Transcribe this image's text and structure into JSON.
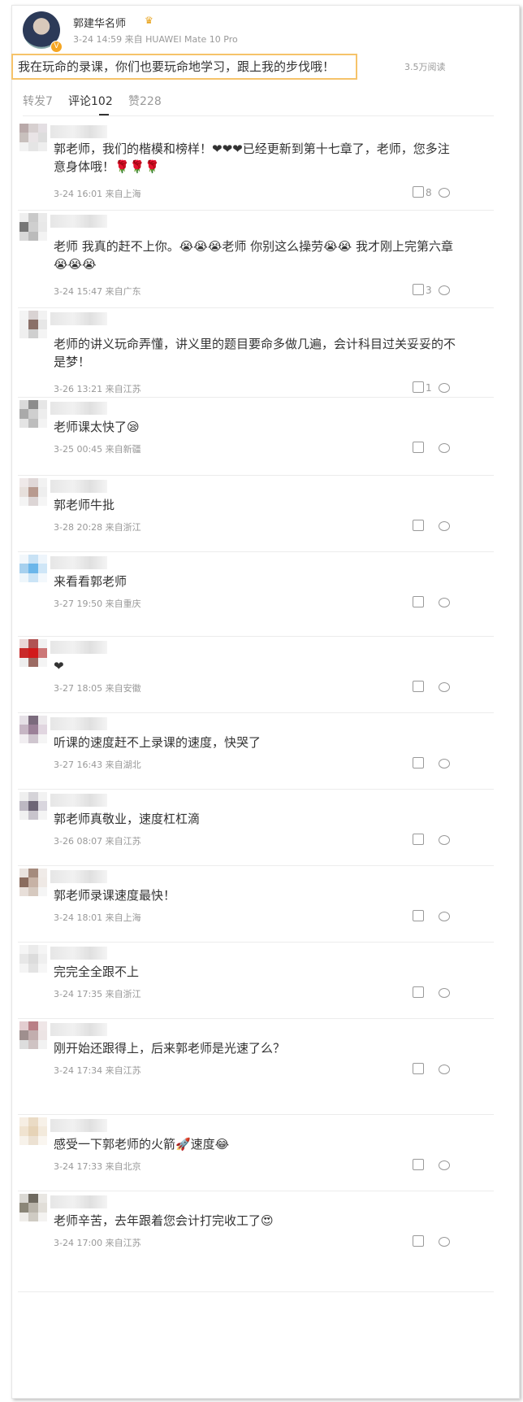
{
  "post": {
    "author": "郭建华名师",
    "meta": "3-24 14:59 来自 HUAWEI Mate 10 Pro",
    "text": "我在玩命的录课，你们也要玩命地学习，跟上我的步伐哦！",
    "reads": "3.5万阅读"
  },
  "tabs": [
    {
      "label": "转发7"
    },
    {
      "label": "评论102"
    },
    {
      "label": "赞228"
    }
  ],
  "comments": [
    {
      "text": "郭老师，我们的楷模和榜样！❤❤❤已经更新到第十七章了，老师，您多注意身体哦！🌹🌹🌹",
      "time": "3-24 16:01 来自上海",
      "likes": "8"
    },
    {
      "text": "老师 我真的赶不上你。😭😭😭老师 你别这么操劳😭😭 我才刚上完第六章😭😭😭",
      "time": "3-24 15:47 来自广东",
      "likes": "3"
    },
    {
      "text": "老师的讲义玩命弄懂，讲义里的题目要命多做几遍，会计科目过关妥妥的不是梦！",
      "time": "3-26 13:21 来自江苏",
      "likes": "1"
    },
    {
      "text": "老师课太快了😪",
      "time": "3-25 00:45 来自新疆",
      "likes": ""
    },
    {
      "text": "郭老师牛批",
      "time": "3-28 20:28 来自浙江",
      "likes": ""
    },
    {
      "text": "来看看郭老师",
      "time": "3-27 19:50 来自重庆",
      "likes": ""
    },
    {
      "text": "❤",
      "time": "3-27 18:05 来自安徽",
      "likes": ""
    },
    {
      "text": "听课的速度赶不上录课的速度，快哭了",
      "time": "3-27 16:43 来自湖北",
      "likes": ""
    },
    {
      "text": "郭老师真敬业，速度杠杠滴",
      "time": "3-26 08:07 来自江苏",
      "likes": ""
    },
    {
      "text": "郭老师录课速度最快！",
      "time": "3-24 18:01 来自上海",
      "likes": ""
    },
    {
      "text": "完完全全跟不上",
      "time": "3-24 17:35 来自浙江",
      "likes": ""
    },
    {
      "text": "刚开始还跟得上，后来郭老师是光速了么？",
      "time": "3-24 17:34 来自江苏",
      "likes": ""
    },
    {
      "text": "感受一下郭老师的火箭🚀速度😂",
      "time": "3-24 17:33 来自北京",
      "likes": ""
    },
    {
      "text": "老师辛苦，去年跟着您会计打完收工了😍",
      "time": "3-24 17:00 来自江苏",
      "likes": ""
    }
  ],
  "colors": {
    "highlight_border": "#f6c36a",
    "meta_gray": "#999999",
    "text": "#333333"
  }
}
